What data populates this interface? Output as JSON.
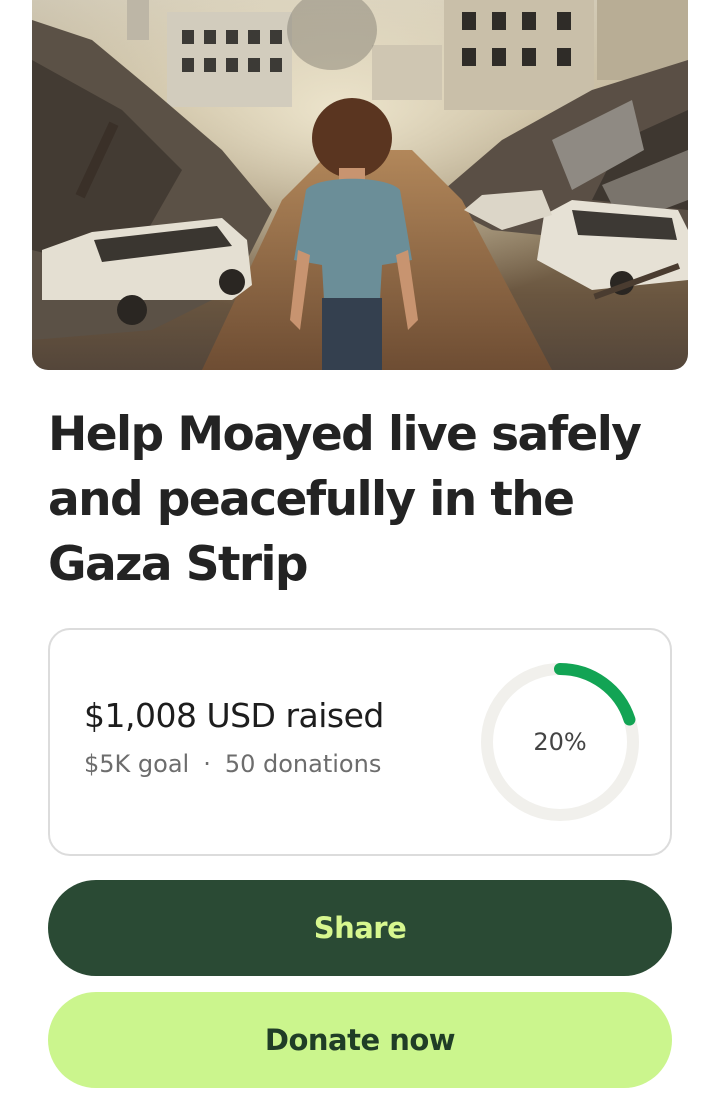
{
  "campaign": {
    "title": "Help Moayed live safely and peacefully in the Gaza Strip"
  },
  "progress": {
    "raised": "$1,008 USD raised",
    "goal": "$5K goal",
    "separator": "·",
    "donations": "50 donations",
    "percent_label": "20%",
    "fraction": 0.2,
    "accent_color": "#12a454",
    "track_color": "#f1f0ec"
  },
  "actions": {
    "share_label": "Share",
    "donate_label": "Donate now"
  }
}
